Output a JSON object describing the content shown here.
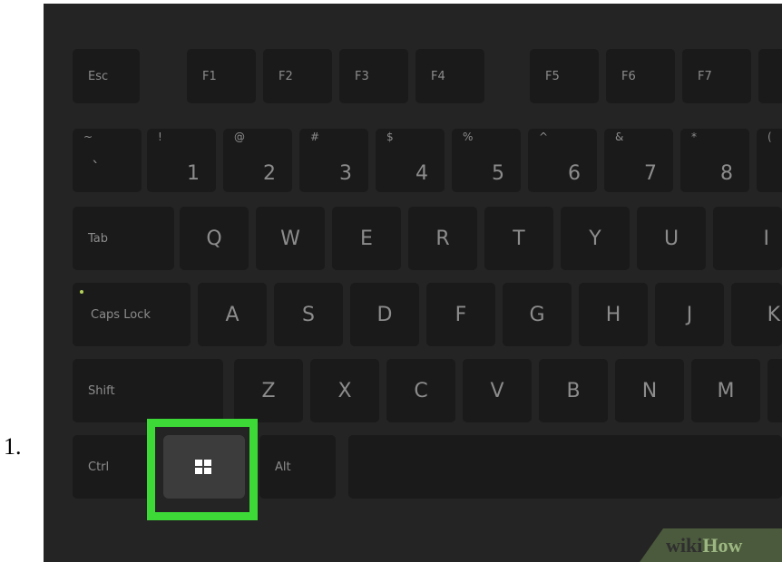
{
  "step": {
    "number": "1."
  },
  "keyboard": {
    "function_row": [
      "Esc",
      "F1",
      "F2",
      "F3",
      "F4",
      "F5",
      "F6",
      "F7"
    ],
    "number_row": [
      {
        "shift": "~",
        "main": "`"
      },
      {
        "shift": "!",
        "main": "1"
      },
      {
        "shift": "@",
        "main": "2"
      },
      {
        "shift": "#",
        "main": "3"
      },
      {
        "shift": "$",
        "main": "4"
      },
      {
        "shift": "%",
        "main": "5"
      },
      {
        "shift": "^",
        "main": "6"
      },
      {
        "shift": "&",
        "main": "7"
      },
      {
        "shift": "*",
        "main": "8"
      },
      {
        "shift": "(",
        "main": ""
      }
    ],
    "qwerty_row": [
      "Tab",
      "Q",
      "W",
      "E",
      "R",
      "T",
      "Y",
      "U",
      "I"
    ],
    "home_row": [
      "Caps Lock",
      "A",
      "S",
      "D",
      "F",
      "G",
      "H",
      "J",
      "K"
    ],
    "shift_row": [
      "Shift",
      "Z",
      "X",
      "C",
      "V",
      "B",
      "N",
      "M",
      ""
    ],
    "bottom_row": [
      "Ctrl",
      "Alt"
    ],
    "highlighted_key": {
      "icon": "windows-logo-icon",
      "highlight_color": "#3cd937"
    }
  },
  "brand": {
    "part1": "wiki",
    "part2": "How"
  }
}
